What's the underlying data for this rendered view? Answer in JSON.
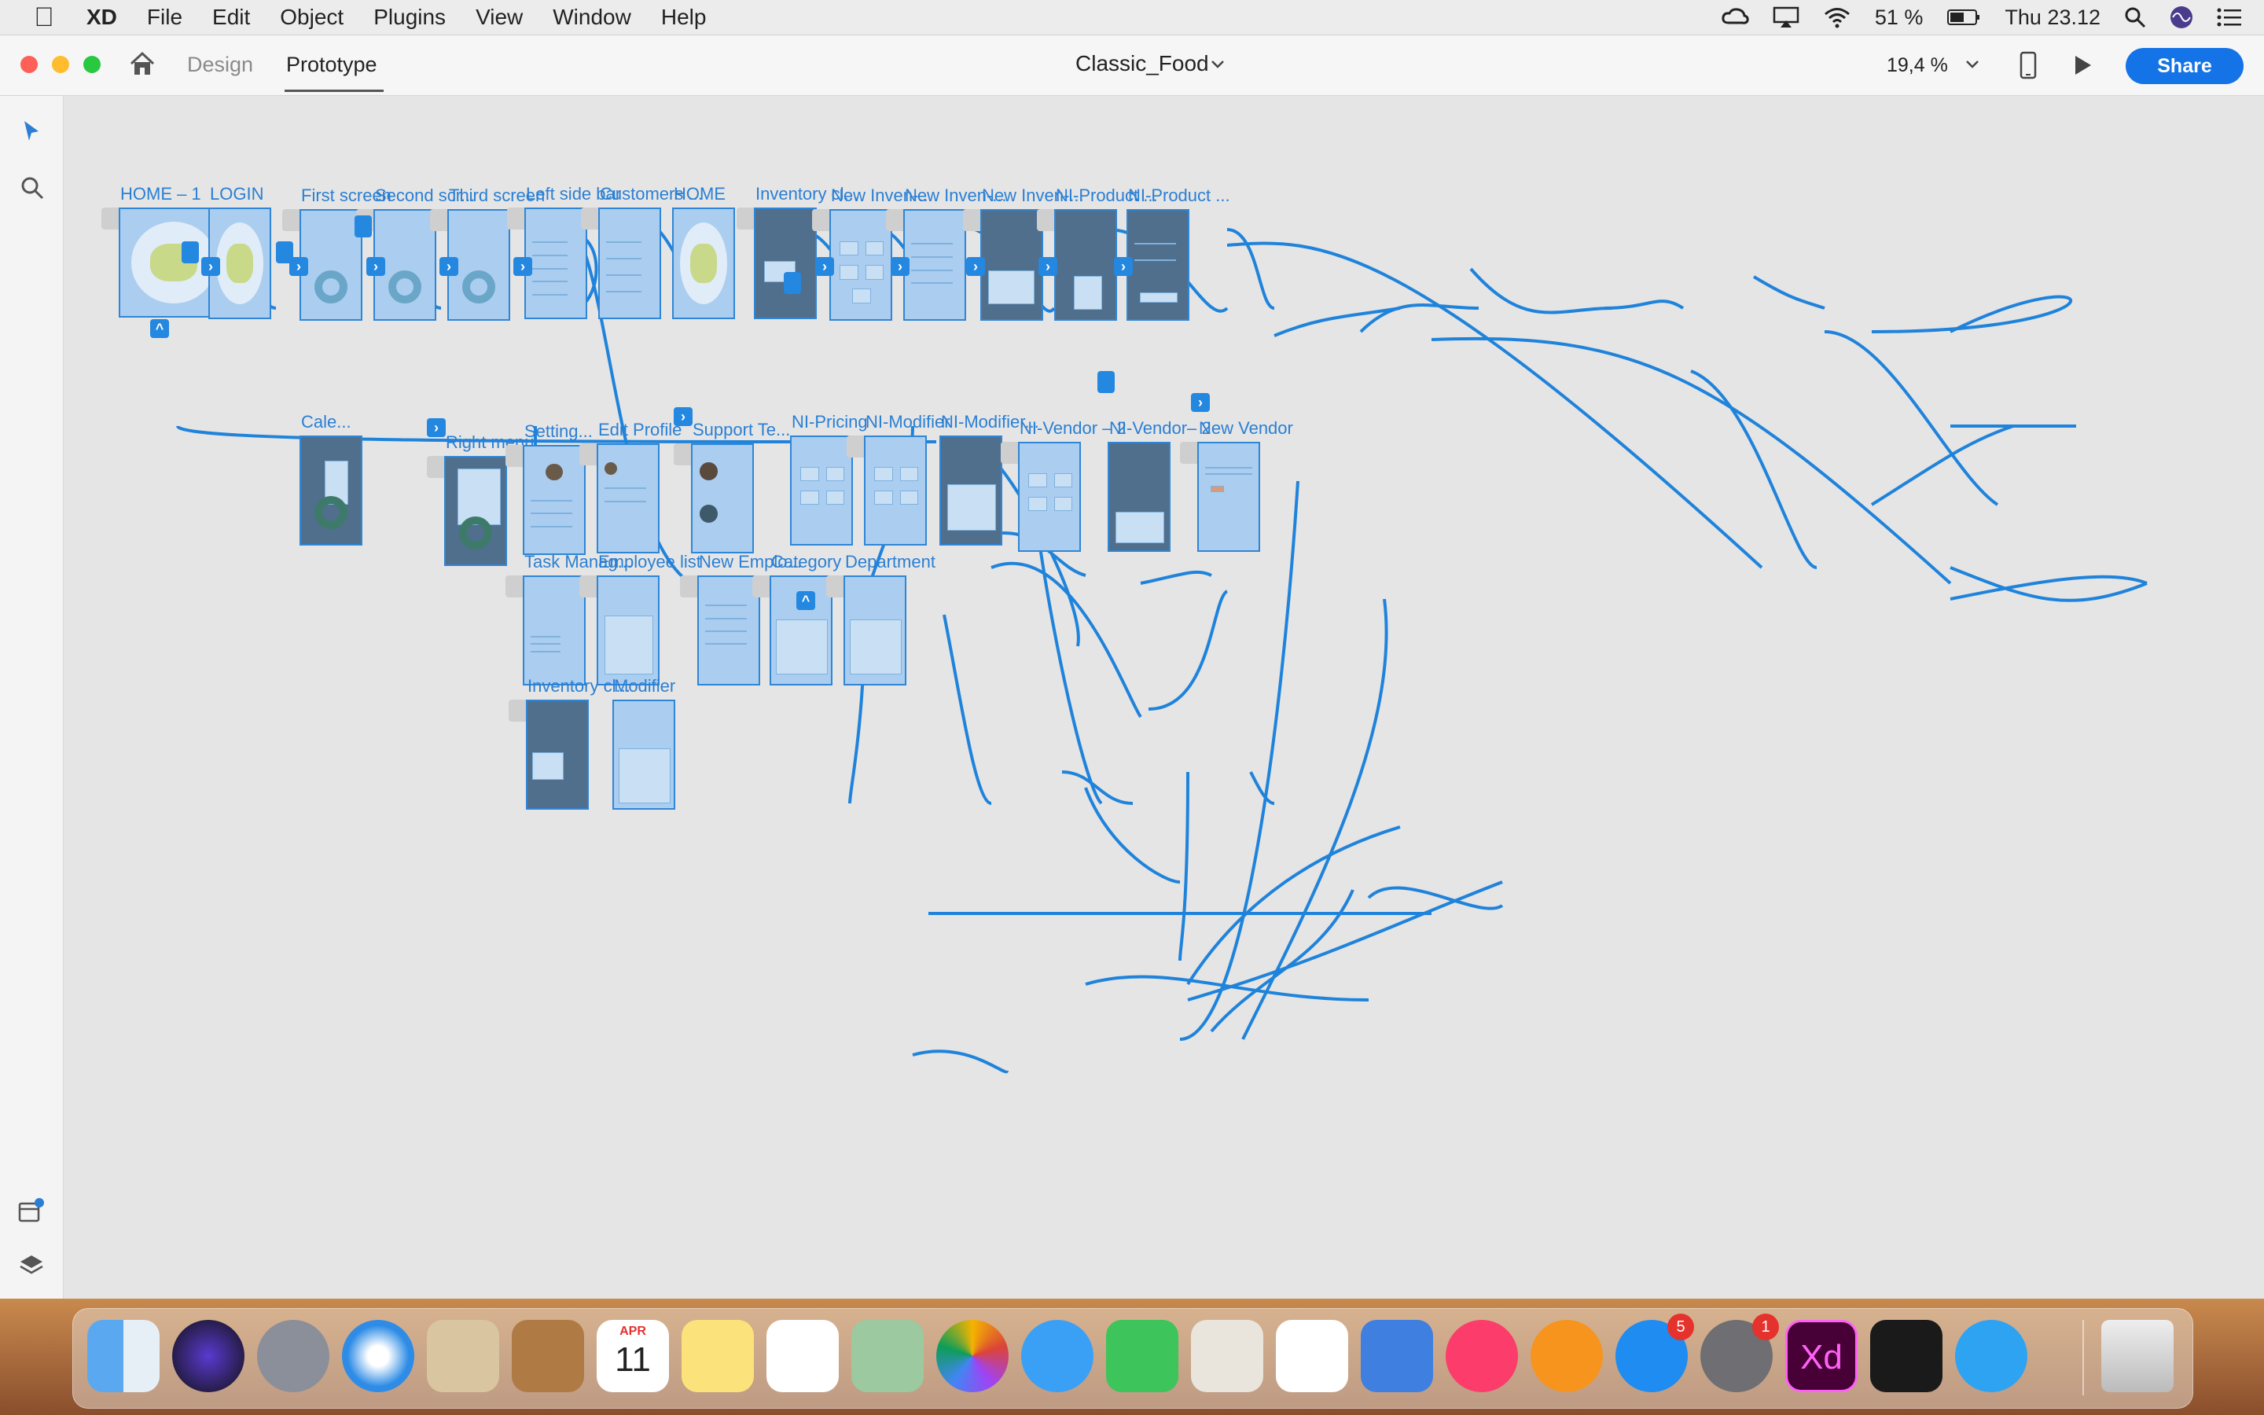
{
  "menubar": {
    "app": "XD",
    "items": [
      "File",
      "Edit",
      "Object",
      "Plugins",
      "View",
      "Window",
      "Help"
    ],
    "battery": "51 %",
    "datetime": "Thu 23.12"
  },
  "titlebar": {
    "tab_design": "Design",
    "tab_prototype": "Prototype",
    "document_title": "Classic_Food",
    "zoom": "19,4 %",
    "share_label": "Share"
  },
  "artboards": {
    "home1": "HOME – 1",
    "login": "LOGIN",
    "first": "First screen",
    "second": "Second scr...",
    "third": "Third screen",
    "leftbar": "Left side bar",
    "customers": "Customers ...",
    "home": "HOME",
    "inventory_cl": "Inventory cl...",
    "newinv1": "New Inven-...",
    "newinv2": "New Inven-...",
    "newinv3": "New Inven-...",
    "niproduct1": "NI-Product ...",
    "niproduct2": "NI-Product ...",
    "calendar": "Cale...",
    "rightmenu": "Right menu...",
    "settings": "Setting...",
    "editprofile": "Edit Profile",
    "support": "Support Te...",
    "nipricing": "NI-Pricing",
    "nimodifier": "NI-Modifier",
    "nimodifier2": "NI-Modifier...",
    "nivendor2a": "NI-Vendor – 2",
    "nivendor2b": "NI-Vendor– 2",
    "newvendor": "New Vendor",
    "taskmanager": "Task Manag...",
    "employeelist": "Employee list",
    "newemployee": "New Emplo...",
    "category": "Category",
    "department": "Department",
    "inventory_cl2": "Inventory cl...",
    "modifier": "Modifier"
  },
  "dock": {
    "calendar_month": "APR",
    "calendar_day": "11",
    "appstore_badge": "5",
    "prefs_badge": "1",
    "xd_label": "Xd"
  }
}
